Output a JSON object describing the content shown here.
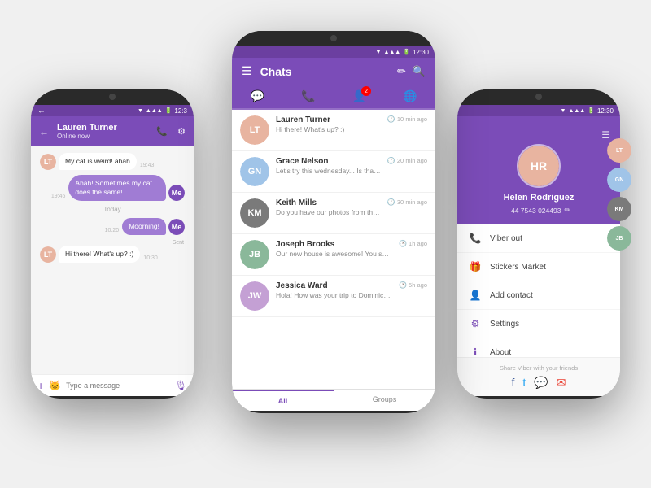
{
  "colors": {
    "purple": "#7b4cb8",
    "purple_dark": "#6b3fa0",
    "purple_light": "#a07cd4",
    "bg": "#f0f0f0",
    "phone": "#2a2a2a"
  },
  "left_phone": {
    "status_time": "12:3",
    "contact_name": "Lauren Turner",
    "contact_status": "Online now",
    "messages": [
      {
        "type": "incoming",
        "text": "My cat is weird! ahah",
        "time": "19:43"
      },
      {
        "type": "outgoing",
        "text": "Ahah! Sometimes my cat does the same!",
        "time": "19:46"
      },
      {
        "type": "divider",
        "text": "Today"
      },
      {
        "type": "outgoing",
        "text": "Moorning!",
        "time": "10:20"
      },
      {
        "type": "status",
        "text": "Sent"
      },
      {
        "type": "incoming",
        "text": "Hi there! What's up? :)",
        "time": "10:30"
      }
    ],
    "input_placeholder": "Type a message",
    "icons": {
      "back": "←",
      "settings": "⚙",
      "call": "📞",
      "plus": "+",
      "sticker": "🐱",
      "mic": "🎙"
    }
  },
  "center_phone": {
    "status_time": "12:30",
    "header_title": "Chats",
    "tabs": [
      {
        "id": "chat",
        "icon": "💬",
        "active": true,
        "badge": null
      },
      {
        "id": "calls",
        "icon": "📞",
        "active": false,
        "badge": null
      },
      {
        "id": "contacts",
        "icon": "👤",
        "active": false,
        "badge": "2"
      },
      {
        "id": "globe",
        "icon": "🌐",
        "active": false,
        "badge": null
      }
    ],
    "chats": [
      {
        "name": "Lauren Turner",
        "message": "Hi there! What's up? :)",
        "time": "10 min ago",
        "avatar_bg": "#e8b4a0",
        "initials": "LT"
      },
      {
        "name": "Grace Nelson",
        "message": "Let's try this wednesday... Is that alright? :)",
        "time": "20 min ago",
        "avatar_bg": "#a0c4e8",
        "initials": "GN"
      },
      {
        "name": "Keith Mills",
        "message": "Do you have our photos from the nye?",
        "time": "30 min ago",
        "avatar_bg": "#7a7a7a",
        "initials": "KM"
      },
      {
        "name": "Joseph Brooks",
        "message": "Our new house is awesome! You should come over to have a look :)",
        "time": "1h ago",
        "avatar_bg": "#8ab89a",
        "initials": "JB"
      },
      {
        "name": "Jessica Ward",
        "message": "Hola! How was your trip to Dominican Republic? OMG So jealous!!",
        "time": "5h ago",
        "avatar_bg": "#c4a0d4",
        "initials": "JW"
      }
    ],
    "bottom_tabs": [
      {
        "label": "All",
        "active": true
      },
      {
        "label": "Groups",
        "active": false
      }
    ],
    "icons": {
      "menu": "☰",
      "edit": "✏",
      "search": "🔍"
    }
  },
  "right_phone": {
    "status_time": "12:30",
    "profile_name": "Helen Rodriguez",
    "profile_phone": "+44 7543 024493",
    "menu_items": [
      {
        "icon": "📞",
        "label": "Viber out"
      },
      {
        "icon": "🎁",
        "label": "Stickers Market"
      },
      {
        "icon": "👤",
        "label": "Add contact"
      },
      {
        "icon": "⚙",
        "label": "Settings"
      },
      {
        "icon": "ℹ",
        "label": "About"
      }
    ],
    "share_text": "Share Viber with your friends",
    "social_icons": [
      "f",
      "t",
      "💬",
      "✉"
    ],
    "side_contacts": [
      {
        "initials": "LT",
        "bg": "#e8b4a0"
      },
      {
        "initials": "GN",
        "bg": "#a0c4e8"
      },
      {
        "initials": "KM",
        "bg": "#7a7a7a"
      },
      {
        "initials": "JB",
        "bg": "#8ab89a"
      }
    ],
    "icons": {
      "menu": "☰",
      "edit": "✏"
    }
  }
}
